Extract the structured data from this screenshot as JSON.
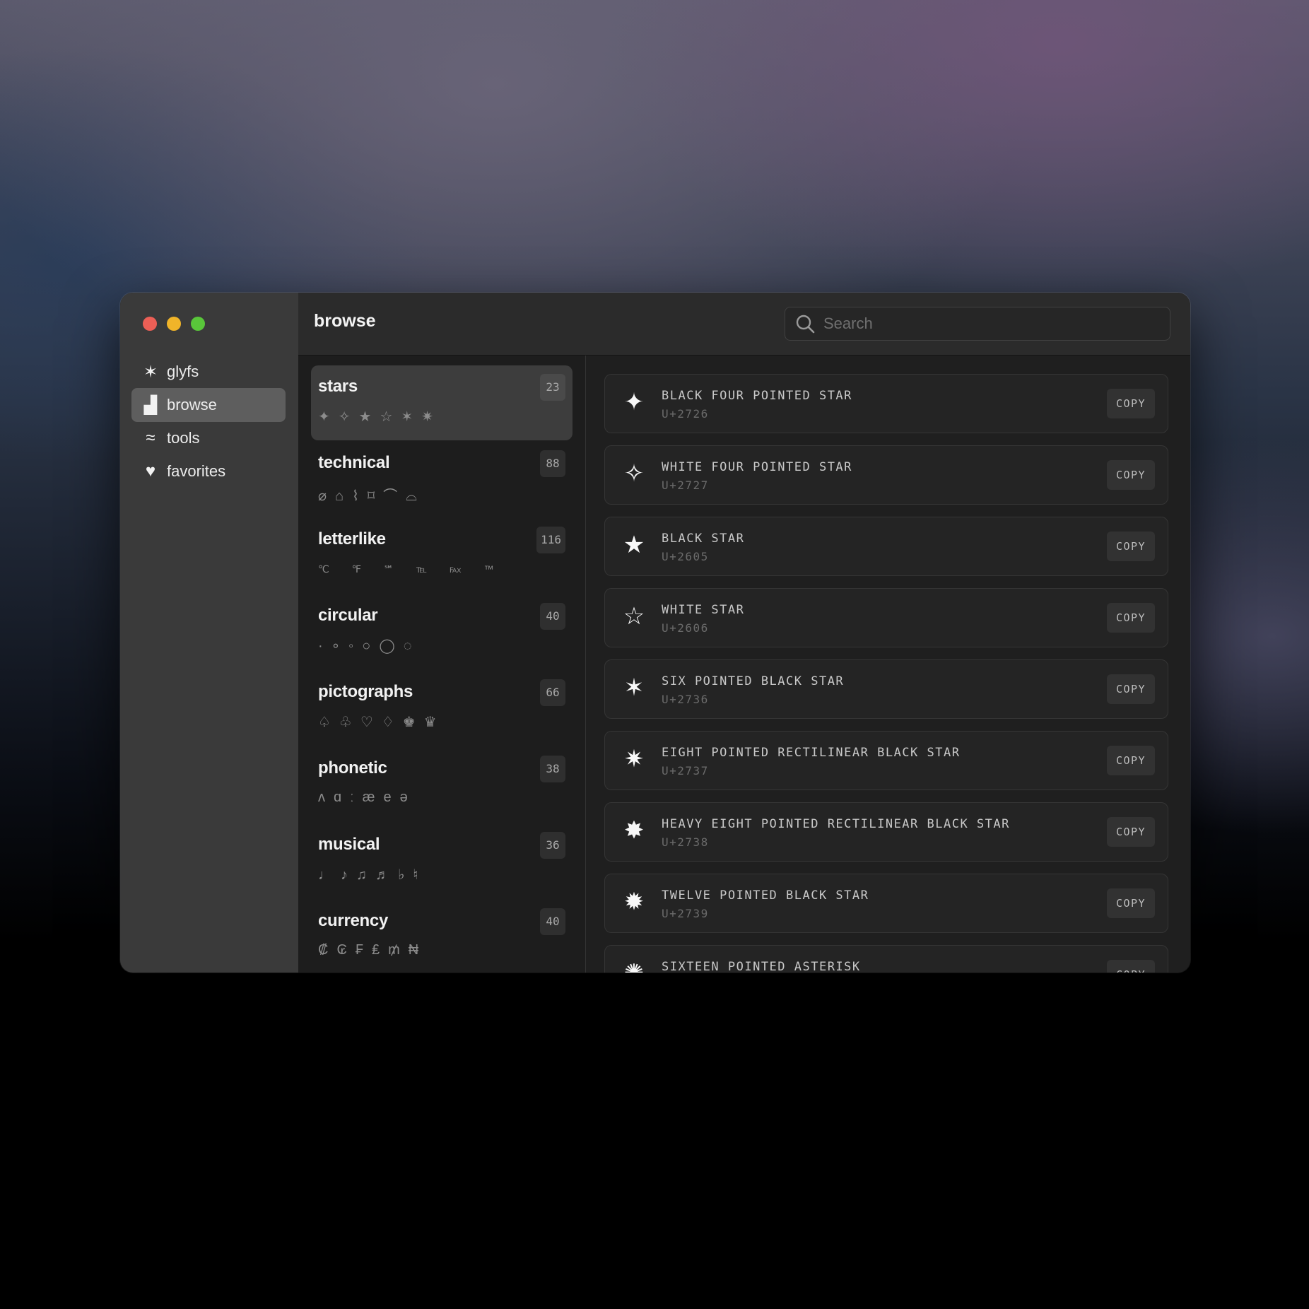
{
  "window": {
    "title": "browse",
    "search_placeholder": "Search"
  },
  "sidebar": {
    "items": [
      {
        "label": "glyfs",
        "icon": "✶",
        "icon_name": "asterisk-star-icon",
        "active": false
      },
      {
        "label": "browse",
        "icon": "▟",
        "icon_name": "browse-blocks-icon",
        "active": true
      },
      {
        "label": "tools",
        "icon": "≈",
        "icon_name": "tilde-tools-icon",
        "active": false
      },
      {
        "label": "favorites",
        "icon": "♥",
        "icon_name": "heart-icon",
        "active": false
      }
    ]
  },
  "categories": [
    {
      "name": "stars",
      "count": "23",
      "glyphs": "✦✧★☆✶✷",
      "active": true
    },
    {
      "name": "technical",
      "count": "88",
      "glyphs": "⌀⌂⌇⌑⌒⌓",
      "active": false
    },
    {
      "name": "letterlike",
      "count": "116",
      "glyphs": "℃ ℉ ℠ ℡ ℻ ™",
      "active": false
    },
    {
      "name": "circular",
      "count": "40",
      "glyphs": "·∘◦○◯◌",
      "active": false
    },
    {
      "name": "pictographs",
      "count": "66",
      "glyphs": "♤♧♡♢♚♛",
      "active": false
    },
    {
      "name": "phonetic",
      "count": "38",
      "glyphs": "ʌɑːæeə",
      "active": false
    },
    {
      "name": "musical",
      "count": "36",
      "glyphs": "♩♪♫♬♭♮",
      "active": false
    },
    {
      "name": "currency",
      "count": "40",
      "glyphs": "₡₢₣₤₥₦",
      "active": false
    }
  ],
  "glyph_rows": [
    {
      "glyph": "✦",
      "name": "BLACK FOUR POINTED STAR",
      "code": "U+2726",
      "copy_label": "COPY"
    },
    {
      "glyph": "✧",
      "name": "WHITE FOUR POINTED STAR",
      "code": "U+2727",
      "copy_label": "COPY"
    },
    {
      "glyph": "★",
      "name": "BLACK STAR",
      "code": "U+2605",
      "copy_label": "COPY"
    },
    {
      "glyph": "☆",
      "name": "WHITE STAR",
      "code": "U+2606",
      "copy_label": "COPY"
    },
    {
      "glyph": "✶",
      "name": "SIX POINTED BLACK STAR",
      "code": "U+2736",
      "copy_label": "COPY"
    },
    {
      "glyph": "✷",
      "name": "EIGHT POINTED RECTILINEAR BLACK STAR",
      "code": "U+2737",
      "copy_label": "COPY"
    },
    {
      "glyph": "✸",
      "name": "HEAVY EIGHT POINTED RECTILINEAR BLACK STAR",
      "code": "U+2738",
      "copy_label": "COPY"
    },
    {
      "glyph": "✹",
      "name": "TWELVE POINTED BLACK STAR",
      "code": "U+2739",
      "copy_label": "COPY"
    },
    {
      "glyph": "✺",
      "name": "SIXTEEN POINTED ASTERISK",
      "code": "",
      "copy_label": "COPY"
    }
  ]
}
